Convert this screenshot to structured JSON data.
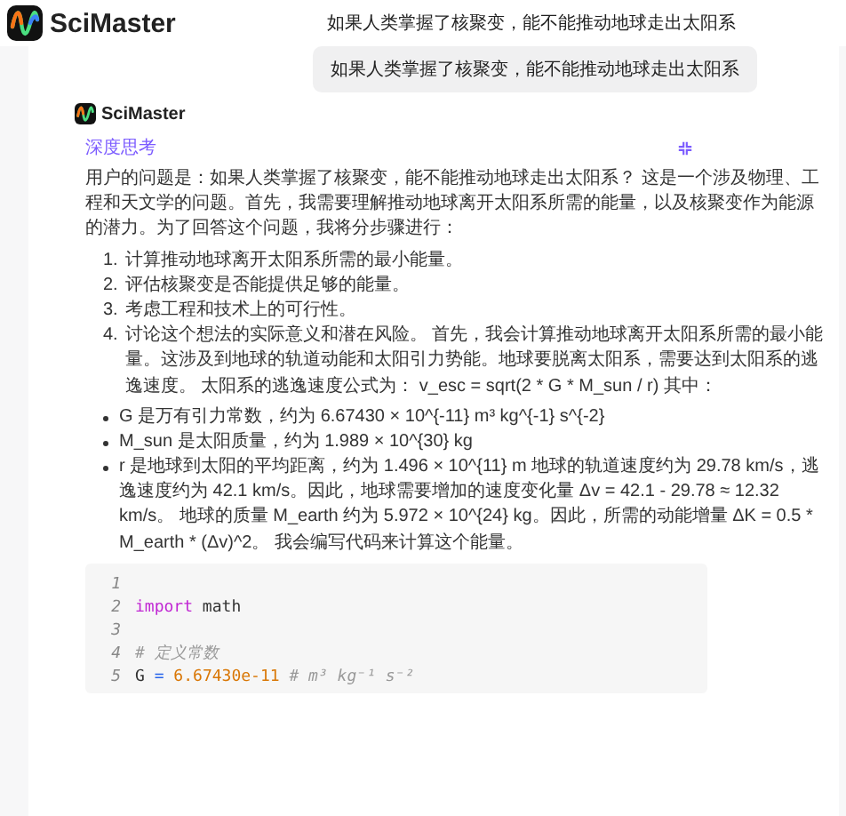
{
  "header": {
    "brand": "SciMaster",
    "title": "如果人类掌握了核聚变，能不能推动地球走出太阳系"
  },
  "user_message": "如果人类掌握了核聚变，能不能推动地球走出太阳系",
  "answer": {
    "brand": "SciMaster",
    "thinking": {
      "label": "深度思考",
      "expanded": true,
      "intro": "用户的问题是：如果人类掌握了核聚变，能不能推动地球走出太阳系？ 这是一个涉及物理、工程和天文学的问题。首先，我需要理解推动地球离开太阳系所需的能量，以及核聚变作为能源的潜力。为了回答这个问题，我将分步骤进行：",
      "steps": [
        {
          "number": "1.",
          "text": "计算推动地球离开太阳系所需的最小能量。"
        },
        {
          "number": "2.",
          "text": "评估核聚变是否能提供足够的能量。"
        },
        {
          "number": "3.",
          "text": "考虑工程和技术上的可行性。"
        },
        {
          "number": "4.",
          "text": "讨论这个想法的实际意义和潜在风险。 首先，我会计算推动地球离开太阳系所需的最小能量。这涉及到地球的轨道动能和太阳引力势能。地球要脱离太阳系，需要达到太阳系的逃逸速度。 太阳系的逃逸速度公式为： v_esc = sqrt(2 * G * M_sun / r) 其中："
        }
      ],
      "bullets": [
        "G 是万有引力常数，约为 6.67430 × 10^{-11} m³ kg^{-1} s^{-2}",
        "M_sun 是太阳质量，约为 1.989 × 10^{30} kg",
        "r 是地球到太阳的平均距离，约为 1.496 × 10^{11} m 地球的轨道速度约为 29.78 km/s，逃逸速度约为 42.1 km/s。因此，地球需要增加的速度变化量 Δv = 42.1 - 29.78 ≈ 12.32 km/s。 地球的质量 M_earth 约为 5.972 × 10^{24} kg。因此，所需的动能增量 ΔK = 0.5 * M_earth * (Δv)^2。 我会编写代码来计算这个能量。"
      ],
      "code": [
        {
          "number": "1"
        },
        {
          "number": "2",
          "tokens": [
            {
              "kind": "keyword",
              "text": "import"
            },
            {
              "kind": "plain",
              "text": " math"
            }
          ]
        },
        {
          "number": "3"
        },
        {
          "number": "4",
          "tokens": [
            {
              "kind": "comment",
              "text": "# 定义常数"
            }
          ]
        },
        {
          "number": "5",
          "tokens": [
            {
              "kind": "plain",
              "text": "G "
            },
            {
              "kind": "operator",
              "text": "="
            },
            {
              "kind": "number",
              "text": " 6.67430e-11"
            },
            {
              "kind": "comment",
              "text": "  # m³ kg⁻¹ s⁻²"
            }
          ]
        }
      ]
    }
  }
}
